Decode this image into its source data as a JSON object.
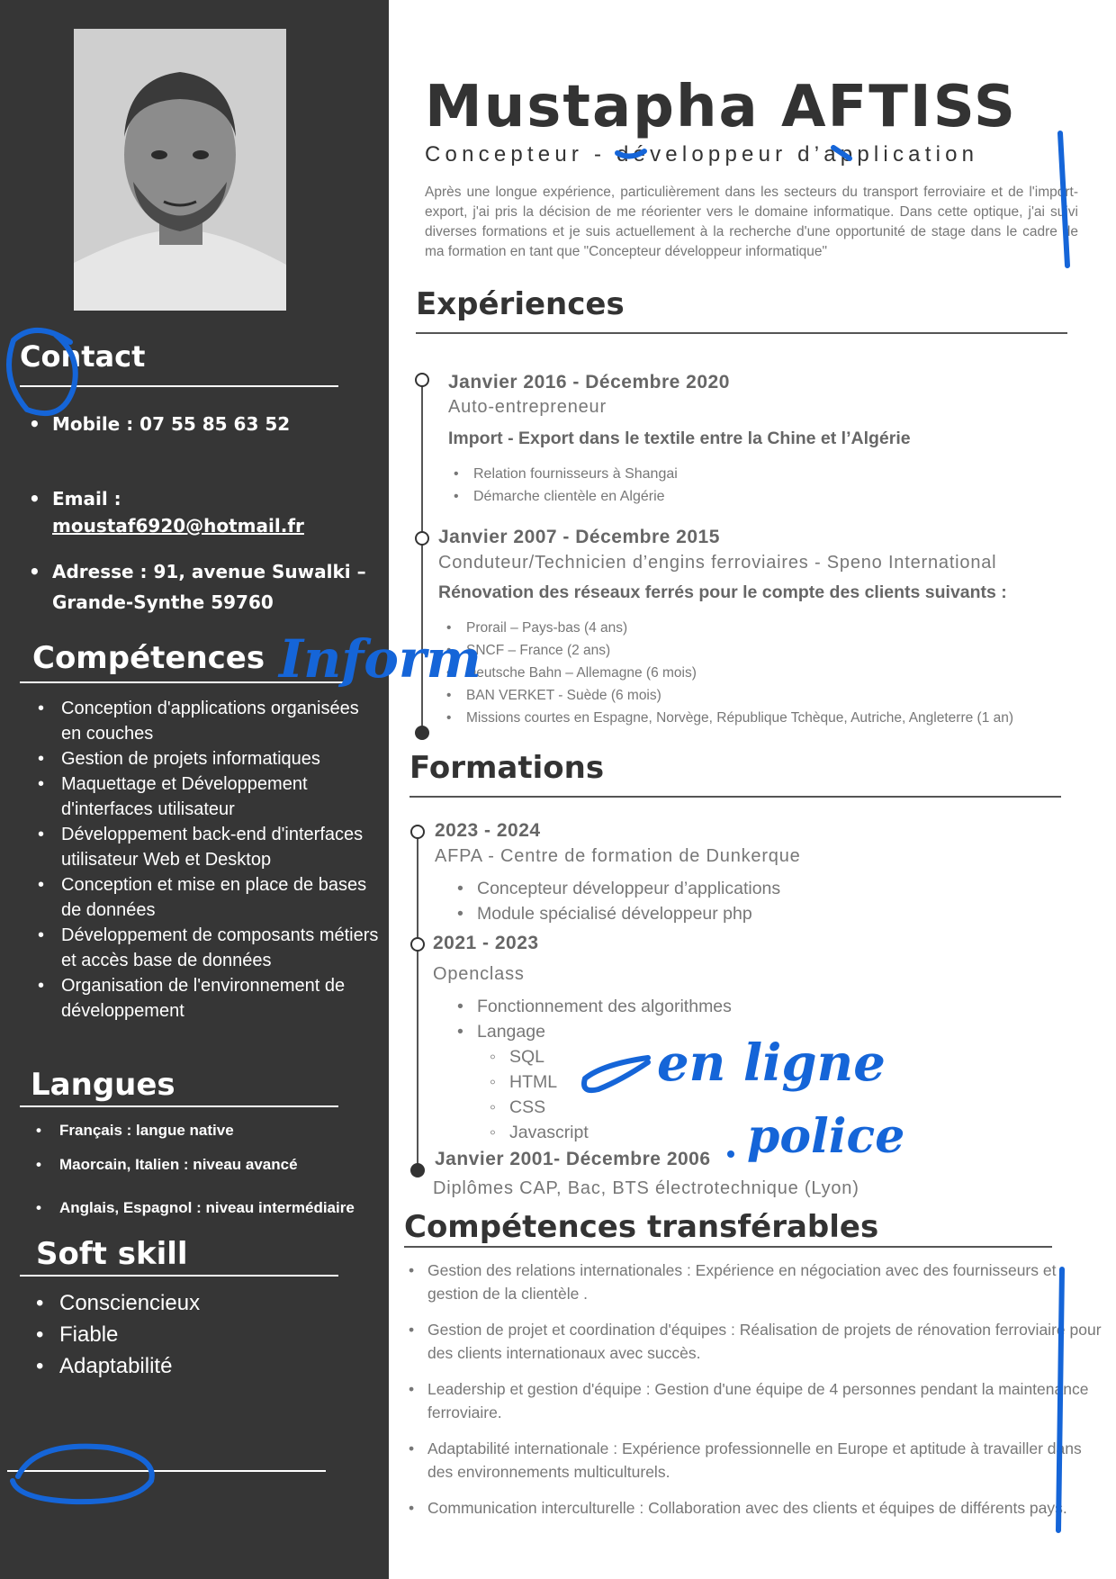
{
  "header": {
    "name": "Mustapha AFTISS",
    "title": "Concepteur - développeur d’application",
    "summary": "Après une longue expérience, particulièrement dans les secteurs du transport ferroviaire et de l'import-export, j'ai pris la décision de me réorienter vers le domaine informatique. Dans cette optique, j'ai suivi diverses formations et je suis actuellement à la recherche d'une opportunité de stage dans le cadre de ma formation en tant que \"Concepteur développeur informatique\""
  },
  "sidebar": {
    "contact_heading": "Contact",
    "mobile": "Mobile : 07 55 85 63 52",
    "email_label": "Email :",
    "email": "moustaf6920@hotmail.fr",
    "address_line1": "Adresse :  91, avenue Suwalki –",
    "address_line2": "Grande-Synthe 59760",
    "skills_heading": "Compétences",
    "skills": [
      " Conception d'applications organisées en couches",
      " Gestion de projets informatiques",
      "Maquettage et Développement d'interfaces utilisateur",
      "Développement back-end d'interfaces utilisateur Web et Desktop",
      "Conception et mise en place de bases de données",
      "Développement de composants métiers et accès base de données",
      "Organisation de l'environnement de développement"
    ],
    "languages_heading": "Langues",
    "languages": [
      "Français : langue native",
      "Maorcain, Italien : niveau avancé",
      "Anglais, Espagnol : niveau intermédiaire"
    ],
    "soft_heading": "Soft skill",
    "soft_skills": [
      "Consciencieux",
      "Fiable",
      "Adaptabilité"
    ]
  },
  "experiences": {
    "heading": "Expériences",
    "items": [
      {
        "date": "Janvier 2016 - Décembre 2020",
        "role": "Auto-entrepreneur",
        "subtitle": "Import - Export dans le textile entre la Chine et l’Algérie",
        "bullets": [
          "Relation fournisseurs à Shangai",
          "Démarche clientèle en Algérie"
        ]
      },
      {
        "date": "Janvier 2007 - Décembre 2015",
        "role": "Conduteur/Technicien d’engins ferroviaires - Speno International",
        "subtitle": "Rénovation des réseaux ferrés pour le compte des clients suivants :",
        "bullets": [
          "Prorail – Pays-bas (4 ans)",
          "SNCF – France (2 ans)",
          "Deutsche Bahn – Allemagne (6 mois)",
          "BAN VERKET - Suède (6 mois)",
          "Missions courtes en Espagne, Norvège, République Tchèque, Autriche, Angleterre (1 an)"
        ]
      }
    ]
  },
  "formations": {
    "heading": "Formations",
    "items": [
      {
        "date": "2023 - 2024",
        "org": "AFPA - Centre de formation de Dunkerque",
        "bullets": [
          "Concepteur développeur d’applications",
          "Module spécialisé  développeur php"
        ]
      },
      {
        "date": "2021 - 2023",
        "org": "Openclass",
        "bullets": [
          "Fonctionnement des algorithmes",
          "Langage"
        ],
        "sub_bullets": [
          "SQL",
          "HTML",
          " CSS",
          "Javascript"
        ]
      },
      {
        "date": "Janvier 2001- Décembre 2006",
        "org": "Diplômes CAP, Bac, BTS électrotechnique (Lyon)"
      }
    ]
  },
  "transferable": {
    "heading": "Compétences transférables",
    "items": [
      "Gestion des relations internationales : Expérience en négociation avec des fournisseurs et gestion de la clientèle .",
      "Gestion de projet et coordination d'équipes : Réalisation de projets de rénovation ferroviaire pour des clients internationaux avec succès.",
      "Leadership et gestion d'équipe : Gestion d'une équipe de 4 personnes pendant la maintenance ferroviaire.",
      "Adaptabilité internationale : Expérience professionnelle en Europe et aptitude à travailler dans des environnements multiculturels.",
      "Communication interculturelle : Collaboration avec des clients et équipes de différents pays."
    ]
  },
  "annotations": {
    "handwriting_1": "Inform",
    "handwriting_2": "en ligne",
    "handwriting_3": "police",
    "ink_color": "#1565d8"
  }
}
